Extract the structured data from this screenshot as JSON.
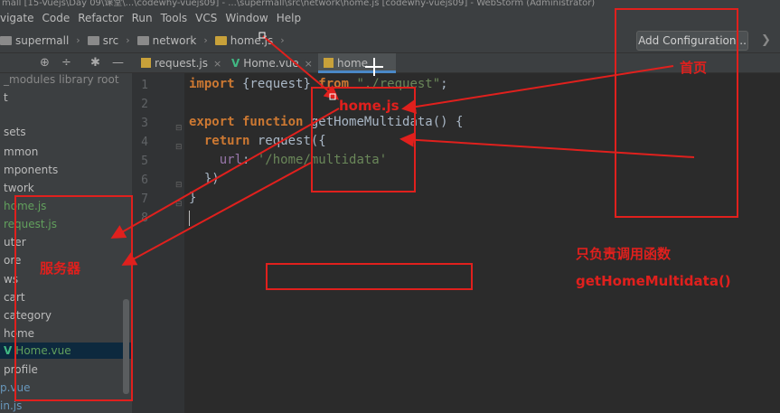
{
  "titlebar": {
    "text": "mall [15-Vuejs\\Day 09\\课堂\\...\\codewhy-vuejs09] - ...\\supermall\\src\\network\\home.js [codewhy-vuejs09] - WebStorm (Administrator)"
  },
  "menu": {
    "items": [
      "vigate",
      "Code",
      "Refactor",
      "Run",
      "Tools",
      "VCS",
      "Window",
      "Help"
    ]
  },
  "breadcrumb": {
    "items": [
      "supermall",
      "src",
      "network",
      "home.js"
    ]
  },
  "toolbar": {
    "add_configuration": "Add Configuration..."
  },
  "sidebar": {
    "items": [
      {
        "label": "_modules  library root",
        "style": "dim"
      },
      {
        "label": "t",
        "style": ""
      },
      {
        "label": "sets",
        "style": ""
      },
      {
        "label": "mmon",
        "style": ""
      },
      {
        "label": "mponents",
        "style": ""
      },
      {
        "label": "twork",
        "style": ""
      },
      {
        "label": "home.js",
        "style": "green"
      },
      {
        "label": "request.js",
        "style": "green"
      },
      {
        "label": "uter",
        "style": ""
      },
      {
        "label": "ore",
        "style": ""
      },
      {
        "label": "ws",
        "style": ""
      },
      {
        "label": "cart",
        "style": ""
      },
      {
        "label": "category",
        "style": ""
      },
      {
        "label": "home",
        "style": ""
      },
      {
        "label": "Home.vue",
        "style": "selected"
      },
      {
        "label": "profile",
        "style": ""
      },
      {
        "label": "p.vue",
        "style": "blue"
      },
      {
        "label": "in.js",
        "style": "blue"
      }
    ]
  },
  "tabs": [
    {
      "label": "request.js",
      "icon": "js-file-icon"
    },
    {
      "label": "Home.vue",
      "icon": "vue-file-icon"
    },
    {
      "label": "home",
      "icon": "js-file-icon",
      "active": true
    }
  ],
  "editor": {
    "line_numbers": [
      "1",
      "2",
      "3",
      "4",
      "5",
      "6",
      "7",
      "8"
    ]
  },
  "annotations": {
    "home_js": "home.js",
    "homepage": "首页",
    "server": "服务器",
    "only_call_line1": "只负责调用函数",
    "only_call_line2": "getHomeMultidata()"
  },
  "colors": {
    "annotation": "#e0201d",
    "keyword": "#cc7832",
    "string": "#6a8759"
  }
}
